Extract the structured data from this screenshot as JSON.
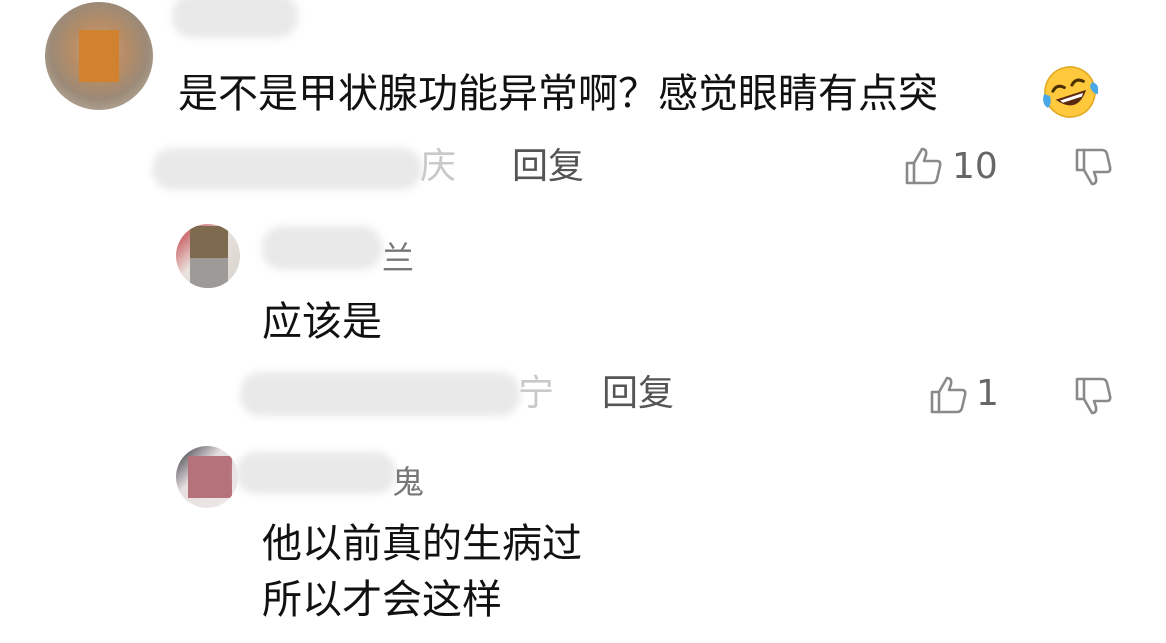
{
  "comments": [
    {
      "text": "是不是甲状腺功能异常啊？感觉眼睛有点突",
      "emoji": "rolling-on-floor-laughing",
      "location_suffix": "庆",
      "reply_label": "回复",
      "like_count": "10"
    },
    {
      "name_suffix": "兰",
      "text": "应该是",
      "location_suffix": "宁",
      "reply_label": "回复",
      "like_count": "1"
    },
    {
      "name_suffix": "鬼",
      "text_lines": [
        "他以前真的生病过",
        "所以才会这样"
      ]
    }
  ],
  "colors": {
    "text": "#111111",
    "meta": "#555555",
    "icon": "#8a8a8a",
    "emoji_face": "#ffc83d",
    "emoji_tears": "#4aa8e8"
  },
  "icons": [
    "thumbs-up-icon",
    "thumbs-down-icon",
    "laughing-crying-emoji"
  ]
}
